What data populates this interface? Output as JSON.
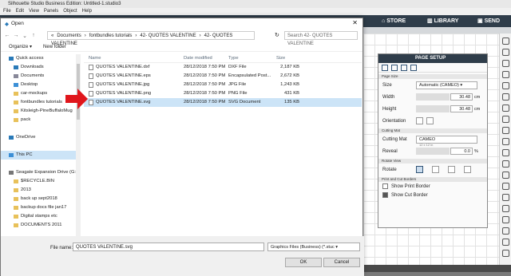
{
  "app": {
    "title": "Silhouette Studio Business Edition: Untitled-1.studio3",
    "menu": [
      "File",
      "Edit",
      "View",
      "Panels",
      "Object",
      "Help"
    ],
    "tabs": [
      {
        "label": "STORE",
        "icon": "store-icon"
      },
      {
        "label": "LIBRARY",
        "icon": "library-icon"
      },
      {
        "label": "SEND",
        "icon": "send-icon"
      }
    ]
  },
  "dialog": {
    "title": "Open",
    "breadcrumb": [
      "«",
      "Documents",
      "›",
      "fontbundles tutorials",
      "›",
      "42- QUOTES VALENTINE",
      "›",
      "42- QUOTES VALENTINE"
    ],
    "search_placeholder": "Search 42- QUOTES VALENTINE",
    "organize": "Organize ▾",
    "new_folder": "New folder",
    "nav": [
      {
        "label": "Quick access",
        "icon": "star-icon",
        "indent": false
      },
      {
        "label": "Downloads",
        "icon": "download-icon",
        "indent": true
      },
      {
        "label": "Documents",
        "icon": "documents-icon",
        "indent": true
      },
      {
        "label": "Desktop",
        "icon": "desktop-icon",
        "indent": true
      },
      {
        "label": "car-mockups",
        "icon": "folder-icon",
        "indent": true
      },
      {
        "label": "fontbundles tutorials",
        "icon": "folder-icon",
        "indent": true
      },
      {
        "label": "Kitsleigh-PineBuffaloMug",
        "icon": "folder-icon",
        "indent": true
      },
      {
        "label": "pack",
        "icon": "folder-icon",
        "indent": true
      },
      {
        "label": "",
        "icon": "",
        "indent": false
      },
      {
        "label": "OneDrive",
        "icon": "cloud-icon",
        "indent": false
      },
      {
        "label": "",
        "icon": "",
        "indent": false
      },
      {
        "label": "This PC",
        "icon": "computer-icon",
        "indent": false,
        "selected": true
      },
      {
        "label": "",
        "icon": "",
        "indent": false
      },
      {
        "label": "Seagate Expansion Drive (G:)",
        "icon": "drive-icon",
        "indent": false
      },
      {
        "label": "$RECYCLE.BIN",
        "icon": "folder-icon",
        "indent": true
      },
      {
        "label": "2013",
        "icon": "folder-icon",
        "indent": true
      },
      {
        "label": "back up sept2018",
        "icon": "folder-icon",
        "indent": true
      },
      {
        "label": "backup docs file jan17",
        "icon": "folder-icon",
        "indent": true
      },
      {
        "label": "Digital stamps etc",
        "icon": "folder-icon",
        "indent": true
      },
      {
        "label": "DOCUMENTS 2011",
        "icon": "folder-icon",
        "indent": true
      }
    ],
    "columns": [
      "Name",
      "Date modified",
      "Type",
      "Size"
    ],
    "files": [
      {
        "name": "QUOTES VALENTINE.dxf",
        "date": "28/12/2018 7:50 PM",
        "type": "DXF File",
        "size": "2,187 KB"
      },
      {
        "name": "QUOTES VALENTINE.eps",
        "date": "28/12/2018 7:50 PM",
        "type": "Encapsulated Post...",
        "size": "2,672 KB"
      },
      {
        "name": "QUOTES VALENTINE.jpg",
        "date": "28/12/2018 7:50 PM",
        "type": "JPG File",
        "size": "1,243 KB"
      },
      {
        "name": "QUOTES VALENTINE.png",
        "date": "28/12/2018 7:50 PM",
        "type": "PNG File",
        "size": "431 KB"
      },
      {
        "name": "QUOTES VALENTINE.svg",
        "date": "28/12/2018 7:50 PM",
        "type": "SVG Document",
        "size": "135 KB",
        "selected": true
      }
    ],
    "filename_label": "File name:",
    "filename": "QUOTES VALENTINE.svg",
    "filetype": "Graphics Files (Business) (*.stuc ▾",
    "ok": "OK",
    "cancel": "Cancel"
  },
  "panel": {
    "title": "PAGE SETUP",
    "page_size_section": "Page Size",
    "size_label": "Size",
    "size_value": "Automatic (CAMEO)",
    "width_label": "Width",
    "width_value": "30.48",
    "height_label": "Height",
    "height_value": "30.48",
    "unit": "cm",
    "orientation_label": "Orientation",
    "cutting_mat_section": "Cutting Mat",
    "cutting_mat_label": "Cutting Mat",
    "cutting_mat_value": "CAMEO",
    "cutting_mat_sub": "12 x 12 in",
    "reveal_label": "Reveal",
    "reveal_value": "0.0",
    "reveal_unit": "%",
    "rotate_section": "Rotate View",
    "rotate_label": "Rotate",
    "borders_section": "Print and Cut Borders",
    "show_print_border": "Show Print Border",
    "show_cut_border": "Show Cut Border",
    "show_print_checked": false,
    "show_cut_checked": true
  },
  "colors": {
    "accent": "#2f3d4a",
    "selection": "#cce4f7",
    "arrow": "#e0161c"
  }
}
